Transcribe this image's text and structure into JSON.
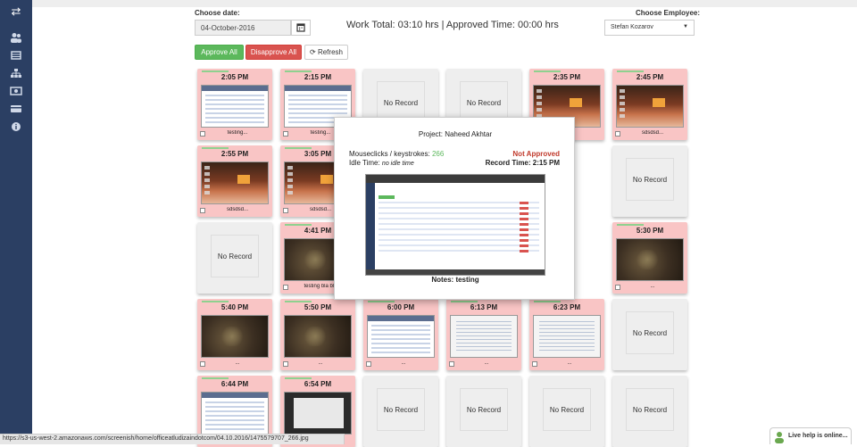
{
  "sidebar": {
    "toggle_icon": "arrows-exchange-icon",
    "items": [
      {
        "icon": "users-icon"
      },
      {
        "icon": "list-icon"
      },
      {
        "icon": "sitemap-icon"
      },
      {
        "icon": "money-icon"
      },
      {
        "icon": "credit-card-icon"
      },
      {
        "icon": "info-icon"
      }
    ]
  },
  "filters": {
    "date_label": "Choose date:",
    "date_value": "04-October-2016",
    "employee_label": "Choose Employee:",
    "employee_value": "Stefan Kozarov"
  },
  "summary": "Work Total: 03:10 hrs | Approved Time: 00:00 hrs",
  "actions": {
    "approve_all": "Approve All",
    "disapprove_all": "Disapprove All",
    "refresh": "Refresh"
  },
  "no_record_text": "No Record",
  "cards": [
    {
      "time": "2:05 PM",
      "type": "browser",
      "note": "testing..."
    },
    {
      "time": "2:15 PM",
      "type": "browser",
      "note": "testing..."
    },
    {
      "time": "",
      "type": "norec",
      "note": ""
    },
    {
      "time": "",
      "type": "norec",
      "note": ""
    },
    {
      "time": "2:35 PM",
      "type": "desk",
      "note": "..."
    },
    {
      "time": "2:45 PM",
      "type": "desk",
      "note": "sdsdsd..."
    },
    {
      "time": "2:55 PM",
      "type": "desk",
      "note": "sdsdsd..."
    },
    {
      "time": "3:05 PM",
      "type": "desk",
      "note": "sdsdsd..."
    },
    {
      "time": "",
      "type": "hidden",
      "note": ""
    },
    {
      "time": "",
      "type": "hidden",
      "note": ""
    },
    {
      "time": "",
      "type": "hidden",
      "note": ""
    },
    {
      "time": "",
      "type": "norec",
      "note": ""
    },
    {
      "time": "",
      "type": "norec",
      "note": ""
    },
    {
      "time": "4:41 PM",
      "type": "game",
      "note": "testing bla bla"
    },
    {
      "time": "",
      "type": "hidden",
      "note": ""
    },
    {
      "time": "",
      "type": "hidden",
      "note": ""
    },
    {
      "time": "",
      "type": "hidden",
      "note": ""
    },
    {
      "time": "5:30 PM",
      "type": "game",
      "note": "..."
    },
    {
      "time": "5:40 PM",
      "type": "game",
      "note": "..."
    },
    {
      "time": "5:50 PM",
      "type": "game",
      "note": "..."
    },
    {
      "time": "6:00 PM",
      "type": "browser",
      "note": "..."
    },
    {
      "time": "6:13 PM",
      "type": "doc",
      "note": "..."
    },
    {
      "time": "6:23 PM",
      "type": "doc",
      "note": "..."
    },
    {
      "time": "",
      "type": "norec",
      "note": ""
    },
    {
      "time": "6:44 PM",
      "type": "browser",
      "note": ""
    },
    {
      "time": "6:54 PM",
      "type": "dark",
      "note": ""
    },
    {
      "time": "",
      "type": "norec",
      "note": ""
    },
    {
      "time": "",
      "type": "norec",
      "note": ""
    },
    {
      "time": "",
      "type": "norec",
      "note": ""
    },
    {
      "time": "",
      "type": "norec",
      "note": ""
    }
  ],
  "modal": {
    "project": "Project: Naheed Akhtar",
    "mk_label": "Mouseclicks / keystrokes:",
    "mk_value": "266",
    "status": "Not Approved",
    "idle_label": "Idle Time:",
    "idle_value": "no idle time",
    "record_time": "Record Time: 2:15 PM",
    "notes": "Notes: testing"
  },
  "status_url": "https://s3-us-west-2.amazonaws.com/screenish/home/officeatludizaindotcom/04.10.2016/1475579707_266.jpg",
  "live_help": "Live help is online...",
  "colors": {
    "sidebar": "#2b3f63",
    "approve": "#5cb85c",
    "disapprove": "#d9534f",
    "card_record": "#f9c5c5",
    "card_empty": "#eeeeee",
    "not_approved": "#c0392b"
  }
}
